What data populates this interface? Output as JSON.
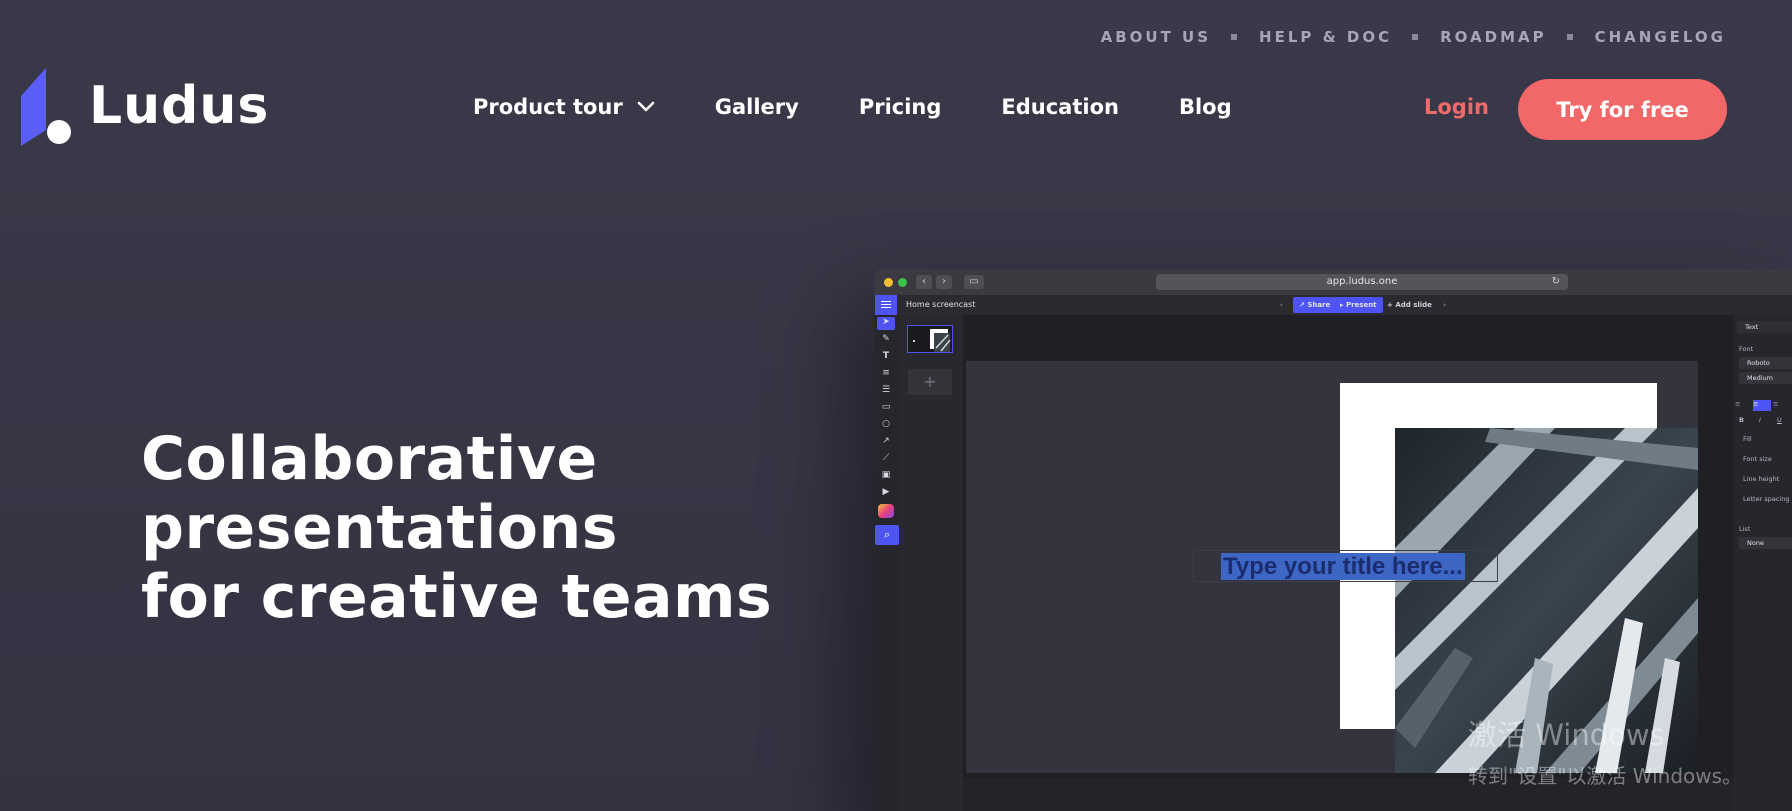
{
  "utility_nav": [
    "ABOUT US",
    "HELP & DOC",
    "ROADMAP",
    "CHANGELOG"
  ],
  "logo": {
    "text": "Ludus",
    "accent": "#5b5ef7"
  },
  "main_nav": {
    "product_tour": "Product tour",
    "gallery": "Gallery",
    "pricing": "Pricing",
    "education": "Education",
    "blog": "Blog"
  },
  "auth": {
    "login": "Login",
    "cta": "Try for free",
    "cta_color": "#f26767"
  },
  "hero": {
    "line1": "Collaborative",
    "line2": "presentations",
    "line3": "for creative teams"
  },
  "app_mockup": {
    "url": "app.ludus.one",
    "doc_name": "Home screencast",
    "toolbar": {
      "share": "Share",
      "present": "Present",
      "add_slide": "Add slide"
    },
    "slide_title_placeholder": "Type your title here...",
    "add_slide_symbol": "+",
    "panel": {
      "text_label": "Text",
      "font_label": "Font",
      "font_family": "Roboto",
      "font_weight": "Medium",
      "fill": "Fill",
      "font_size": "Font size",
      "line_height": "Line height",
      "letter_spacing": "Letter spacing",
      "list": "List",
      "list_value": "None"
    }
  },
  "watermark": {
    "line1": "激活 Windows",
    "line2": "转到\"设置\"以激活 Windows。"
  }
}
